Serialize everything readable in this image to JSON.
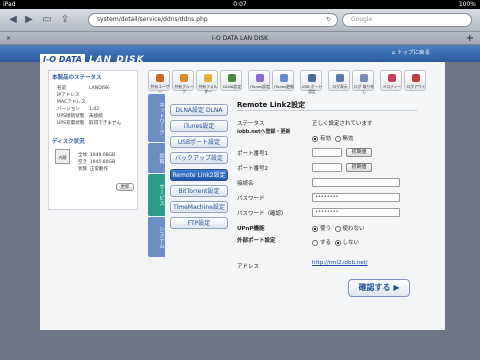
{
  "statusbar": {
    "device": "iPad",
    "time": "0:07",
    "battery": "100%"
  },
  "browser": {
    "url": "system/detail/service/ddns/ddns.php",
    "search_placeholder": "Google",
    "tab_title": "I-O DATA LAN DISK",
    "tab_close": "×",
    "new_tab": "+"
  },
  "header": {
    "logo_box": "I-O DATA",
    "logo_text": "LAN DISK",
    "top_link": "⌂ トップに戻る"
  },
  "status_panel": {
    "title": "本製品のステータス",
    "rows": [
      {
        "k": "名前",
        "v": "LANDISK-"
      },
      {
        "k": "IPアドレス",
        "v": ""
      },
      {
        "k": "MACアドレス",
        "v": ""
      },
      {
        "k": "バージョン",
        "v": "1.02"
      },
      {
        "k": "UPS接続状態",
        "v": "未接続"
      },
      {
        "k": "UPS充電状態",
        "v": "取得できません"
      }
    ],
    "disk_title": "ディスク状況",
    "disk_label": "内蔵",
    "disk_rows": [
      {
        "k": "全体",
        "v": "1949.08GB"
      },
      {
        "k": "空き",
        "v": "1945.80GB"
      },
      {
        "k": "状態",
        "v": "正常動作"
      }
    ],
    "refresh": "更新"
  },
  "side_tabs": [
    "ネットワーク",
    "共有",
    "サービス",
    "システム"
  ],
  "icon_buttons": [
    {
      "label": "共有ユーザー",
      "icon": "users-icon",
      "color": "#c96a2a"
    },
    {
      "label": "共有グループ",
      "icon": "group-icon",
      "color": "#d98c2a"
    },
    {
      "label": "共有フォルダー",
      "icon": "folder-icon",
      "color": "#e0b030"
    },
    {
      "label": "DLNA設定",
      "icon": "dlna-icon",
      "color": "#4a8a3a"
    },
    {
      "label": "iTunes設定",
      "icon": "itunes-icon",
      "color": "#8a6ad0"
    },
    {
      "label": "iTunes更新",
      "icon": "itunes-update-icon",
      "color": "#6a8ad0"
    },
    {
      "label": "USB ポート設定",
      "icon": "usb-icon",
      "color": "#4a6aa0"
    },
    {
      "label": "ログ表示",
      "icon": "log-icon",
      "color": "#5a7ab0"
    },
    {
      "label": "ログ 取り外し",
      "icon": "eject-icon",
      "color": "#7a8ab0"
    },
    {
      "label": "メロディー",
      "icon": "melody-icon",
      "color": "#c04060"
    },
    {
      "label": "ログアウト",
      "icon": "logout-icon",
      "color": "#c04040"
    }
  ],
  "service_buttons": [
    {
      "label": "DLNA設定 DLNA",
      "active": false
    },
    {
      "label": "iTunes設定",
      "active": false
    },
    {
      "label": "USBポート設定",
      "active": false
    },
    {
      "label": "バックアップ設定",
      "active": false
    },
    {
      "label": "Remote Link2設定",
      "active": true
    },
    {
      "label": "BitTorrent設定",
      "active": false
    },
    {
      "label": "TimeMachine設定",
      "active": false
    },
    {
      "label": "FTP設定",
      "active": false
    }
  ],
  "form": {
    "title": "Remote Link2設定",
    "status_label": "ステータス",
    "status_value": "正しく設定されています",
    "iobb_label": "iobb.netへ登録・更新",
    "iobb_on": "有効",
    "iobb_off": "無効",
    "port1_label": "ポート番号1",
    "port2_label": "ポート番号2",
    "init_btn": "初期値",
    "connection_label": "接続名",
    "password_label": "パスワード",
    "password_confirm_label": "パスワード（確認）",
    "password_mask": "••••••••",
    "upnp_label": "UPnP機能",
    "upnp_on": "使う",
    "upnp_off": "使わない",
    "external_label": "外部ポート設定",
    "external_on": "する",
    "external_off": "しない",
    "address_label": "アドレス",
    "address_value": "http://rml2.iobb.net/",
    "confirm": "確認する ▶"
  }
}
